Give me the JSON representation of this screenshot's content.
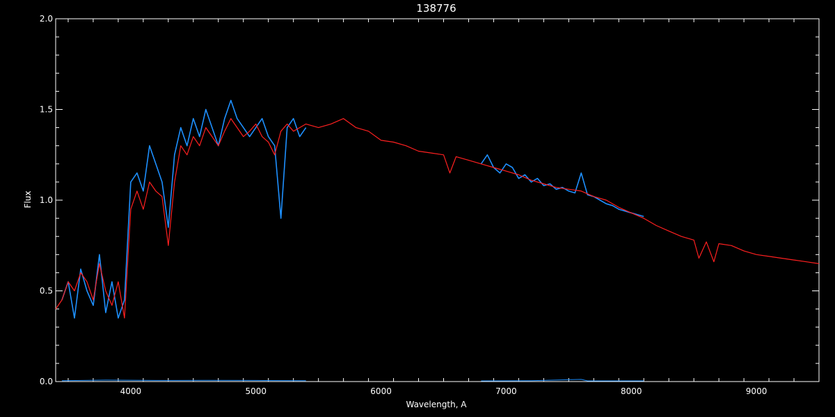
{
  "chart_data": {
    "type": "line",
    "title": "138776",
    "xlabel": "Wavelength, A",
    "ylabel": "Flux",
    "xlim": [
      3400,
      9500
    ],
    "ylim": [
      0.0,
      2.0
    ],
    "x_ticks": [
      "4000",
      "5000",
      "6000",
      "7000",
      "8000",
      "9000"
    ],
    "y_ticks": [
      "0.0",
      "0.5",
      "1.0",
      "1.5",
      "2.0"
    ],
    "grid": false,
    "background": "#000000",
    "colors": {
      "axes": "#ffffff",
      "observed": "#1e90ff",
      "model": "#ff2020",
      "error": "#1e90ff"
    },
    "series": [
      {
        "role": "observed",
        "segments": [
          {
            "x": [
              3450,
              3500,
              3550,
              3600,
              3650,
              3700,
              3750,
              3800,
              3850,
              3900,
              3950,
              4000,
              4050,
              4100,
              4150,
              4200,
              4250,
              4300,
              4350,
              4400,
              4450,
              4500,
              4550,
              4600,
              4650,
              4700,
              4750,
              4800,
              4850,
              4900,
              4950,
              5000,
              5050,
              5100,
              5150,
              5200,
              5250,
              5300,
              5350,
              5400
            ],
            "y": [
              0.45,
              0.55,
              0.35,
              0.62,
              0.5,
              0.42,
              0.7,
              0.38,
              0.55,
              0.35,
              0.45,
              1.1,
              1.15,
              1.05,
              1.3,
              1.2,
              1.1,
              0.85,
              1.25,
              1.4,
              1.3,
              1.45,
              1.35,
              1.5,
              1.4,
              1.3,
              1.45,
              1.55,
              1.45,
              1.4,
              1.35,
              1.4,
              1.45,
              1.35,
              1.3,
              0.9,
              1.4,
              1.45,
              1.35,
              1.4
            ]
          },
          {
            "x": [
              6800,
              6850,
              6900,
              6950,
              7000,
              7050,
              7100,
              7150,
              7200,
              7250,
              7300,
              7350,
              7400,
              7450,
              7500,
              7550,
              7600,
              7650,
              7700,
              7750,
              7800,
              7850,
              7900,
              7950,
              8000,
              8050,
              8100
            ],
            "y": [
              1.2,
              1.25,
              1.18,
              1.15,
              1.2,
              1.18,
              1.12,
              1.14,
              1.1,
              1.12,
              1.08,
              1.09,
              1.06,
              1.07,
              1.05,
              1.04,
              1.15,
              1.03,
              1.02,
              1.0,
              0.98,
              0.97,
              0.95,
              0.94,
              0.93,
              0.92,
              0.91
            ]
          }
        ]
      },
      {
        "role": "model",
        "x": [
          3400,
          3450,
          3500,
          3550,
          3600,
          3650,
          3700,
          3750,
          3800,
          3850,
          3900,
          3950,
          4000,
          4050,
          4100,
          4150,
          4200,
          4250,
          4300,
          4350,
          4400,
          4450,
          4500,
          4550,
          4600,
          4650,
          4700,
          4750,
          4800,
          4850,
          4900,
          4950,
          5000,
          5050,
          5100,
          5150,
          5200,
          5250,
          5300,
          5350,
          5400,
          5500,
          5600,
          5700,
          5800,
          5900,
          6000,
          6100,
          6200,
          6300,
          6400,
          6500,
          6550,
          6600,
          6700,
          6800,
          6900,
          7000,
          7100,
          7200,
          7300,
          7400,
          7500,
          7600,
          7700,
          7800,
          7900,
          8000,
          8100,
          8200,
          8300,
          8400,
          8500,
          8540,
          8600,
          8660,
          8700,
          8800,
          8900,
          9000,
          9100,
          9200,
          9300,
          9400,
          9500
        ],
        "y": [
          0.4,
          0.45,
          0.55,
          0.5,
          0.6,
          0.55,
          0.45,
          0.65,
          0.5,
          0.42,
          0.55,
          0.35,
          0.95,
          1.05,
          0.95,
          1.1,
          1.05,
          1.02,
          0.75,
          1.1,
          1.3,
          1.25,
          1.35,
          1.3,
          1.4,
          1.35,
          1.3,
          1.38,
          1.45,
          1.4,
          1.35,
          1.38,
          1.42,
          1.35,
          1.32,
          1.25,
          1.38,
          1.42,
          1.38,
          1.4,
          1.42,
          1.4,
          1.42,
          1.45,
          1.4,
          1.38,
          1.33,
          1.32,
          1.3,
          1.27,
          1.26,
          1.25,
          1.15,
          1.24,
          1.22,
          1.2,
          1.18,
          1.16,
          1.14,
          1.11,
          1.09,
          1.07,
          1.06,
          1.05,
          1.02,
          1.0,
          0.96,
          0.93,
          0.9,
          0.86,
          0.83,
          0.8,
          0.78,
          0.68,
          0.77,
          0.66,
          0.76,
          0.75,
          0.72,
          0.7,
          0.69,
          0.68,
          0.67,
          0.66,
          0.65
        ]
      },
      {
        "role": "error",
        "segments": [
          {
            "x": [
              3450,
              3800,
              4200,
              4600,
              5000,
              5400
            ],
            "y": [
              0.005,
              0.008,
              0.006,
              0.007,
              0.006,
              0.005
            ]
          },
          {
            "x": [
              6800,
              7200,
              7600,
              7650,
              7700,
              8100
            ],
            "y": [
              0.004,
              0.005,
              0.012,
              0.004,
              0.004,
              0.004
            ]
          }
        ]
      }
    ]
  }
}
